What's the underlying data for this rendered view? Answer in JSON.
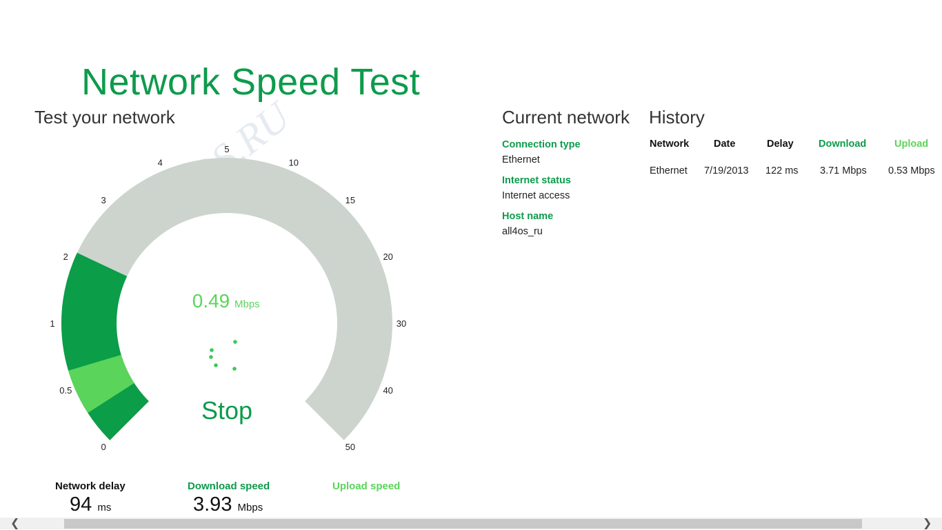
{
  "app": {
    "title": "Network Speed Test",
    "watermark": "All4OS.RU"
  },
  "test": {
    "heading": "Test your network",
    "current_speed": "0.49",
    "current_unit": "Mbps",
    "action_label": "Stop",
    "gauge": {
      "scale_labels": [
        "0",
        "0.5",
        "1",
        "2",
        "3",
        "4",
        "5",
        "10",
        "15",
        "20",
        "30",
        "40",
        "50"
      ],
      "progress_fraction": 0.26,
      "current_fraction": 0.06,
      "colors": {
        "track": "#cdd4cd",
        "progress": "#0b9d48",
        "current": "#5ad45a",
        "accent": "#0d9b4c"
      }
    }
  },
  "metrics": {
    "delay": {
      "label": "Network delay",
      "value": "94",
      "unit": "ms"
    },
    "download": {
      "label": "Download speed",
      "value": "3.93",
      "unit": "Mbps"
    },
    "upload": {
      "label": "Upload speed"
    }
  },
  "current_network": {
    "heading": "Current network",
    "connection_type": {
      "label": "Connection type",
      "value": "Ethernet"
    },
    "internet_status": {
      "label": "Internet status",
      "value": "Internet access"
    },
    "host_name": {
      "label": "Host name",
      "value": "all4os_ru"
    }
  },
  "history": {
    "heading": "History",
    "columns": [
      "Network",
      "Date",
      "Delay",
      "Download",
      "Upload"
    ],
    "rows": [
      {
        "network": "Ethernet",
        "date": "7/19/2013",
        "delay": "122 ms",
        "download": "3.71 Mbps",
        "upload": "0.53 Mbps"
      }
    ]
  },
  "icons": {
    "scroll_left": "chevron-left-icon",
    "scroll_right": "chevron-right-icon"
  }
}
